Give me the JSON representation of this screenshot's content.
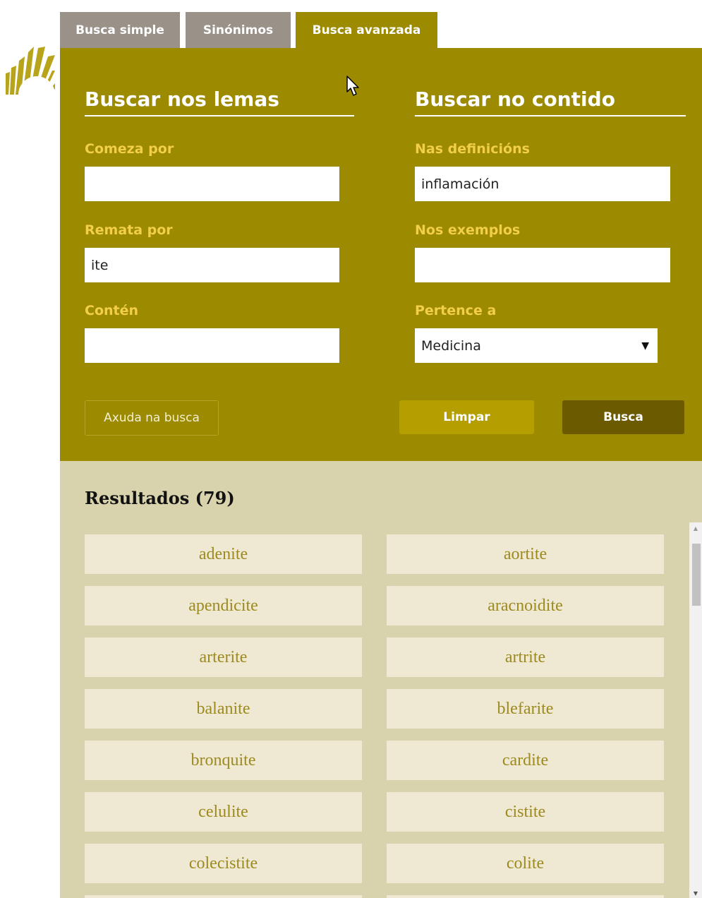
{
  "tabs": [
    {
      "label": "Busca simple",
      "active": false
    },
    {
      "label": "Sinónimos",
      "active": false
    },
    {
      "label": "Busca avanzada",
      "active": true
    }
  ],
  "lemmas": {
    "title": "Buscar nos lemas",
    "starts_with": {
      "label": "Comeza por",
      "value": ""
    },
    "ends_with": {
      "label": "Remata por",
      "value": "ite"
    },
    "contains": {
      "label": "Contén",
      "value": ""
    }
  },
  "content": {
    "title": "Buscar no contido",
    "definitions": {
      "label": "Nas definicións",
      "value": "inflamación"
    },
    "examples": {
      "label": "Nos exemplos",
      "value": ""
    },
    "belongs_to": {
      "label": "Pertence a",
      "value": "Medicina"
    }
  },
  "buttons": {
    "help": "Axuda na busca",
    "clear": "Limpar",
    "search": "Busca"
  },
  "results": {
    "title": "Resultados (79)",
    "items": [
      "adenite",
      "aortite",
      "apendicite",
      "aracnoidite",
      "arterite",
      "artrite",
      "balanite",
      "blefarite",
      "bronquite",
      "cardite",
      "celulite",
      "cistite",
      "colecistite",
      "colite"
    ]
  },
  "colors": {
    "panel": "#9c8a00",
    "label": "#f2ce4a",
    "results_bg": "#d8d2ad",
    "item_bg": "#efe9d4",
    "item_text": "#9c8a1e"
  }
}
